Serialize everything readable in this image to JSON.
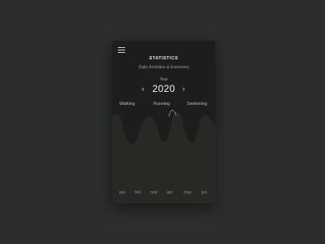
{
  "header": {
    "title": "STATISTICS",
    "subtitle": "Daily Activities & Exercises"
  },
  "year_selector": {
    "label": "Year",
    "value": "2020",
    "prev_icon": "chevron-left-icon",
    "next_icon": "chevron-right-icon"
  },
  "activities": [
    "Walking",
    "Running",
    "Swimming"
  ],
  "selected_activity": "Running",
  "months": [
    "jan",
    "feb",
    "mar",
    "apr",
    "may",
    "jun"
  ],
  "colors": {
    "background": "#2b2d2f",
    "card": "#1d1d1d",
    "wave_fill": "#2a2824",
    "highlight": "#d8d1bc"
  },
  "icons": {
    "menu": "hamburger-menu-icon"
  }
}
